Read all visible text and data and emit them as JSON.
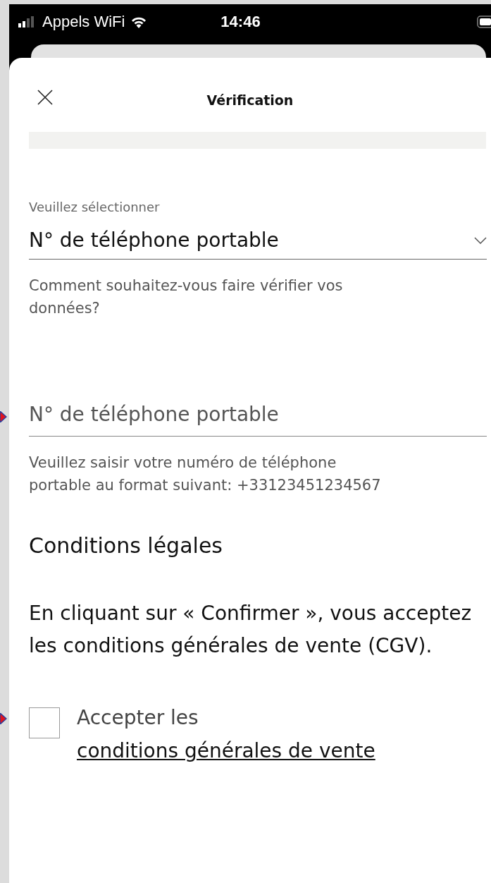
{
  "status_bar": {
    "carrier": "Appels WiFi",
    "time": "14:46"
  },
  "header": {
    "title": "Vérification"
  },
  "method_select": {
    "label": "Veuillez sélectionner",
    "value": "N° de téléphone portable",
    "help": "Comment souhaitez-vous faire vérifier vos données?"
  },
  "phone_field": {
    "placeholder": "N° de téléphone portable",
    "help": "Veuillez saisir votre numéro de téléphone portable au format suivant: +33123451234567"
  },
  "legal": {
    "heading": "Conditions légales",
    "text": "En cliquant sur « Confirmer », vous acceptez les conditions générales de vente (CGV).",
    "checkbox": {
      "checked": false,
      "label": "Accepter les ",
      "link": "conditions générales de vente"
    }
  }
}
